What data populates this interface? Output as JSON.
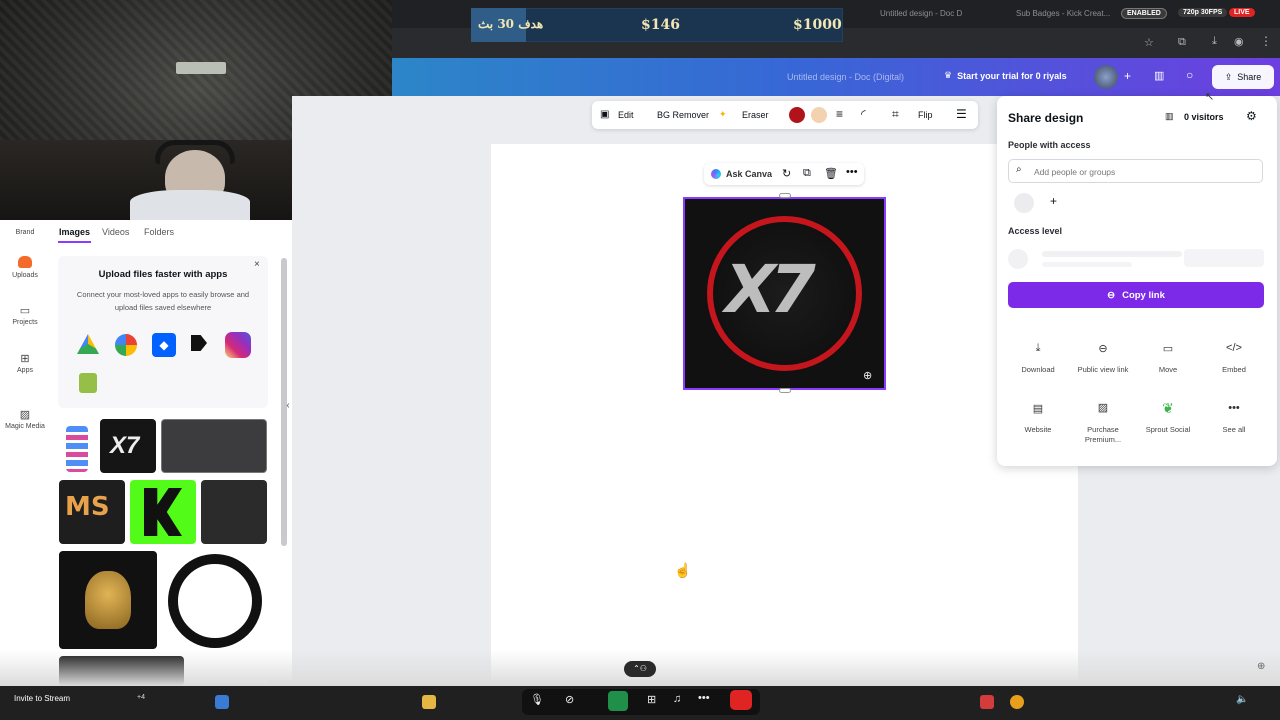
{
  "stream_overlay": {
    "goal_label": "هدف 30 بث",
    "donation_current": "$146",
    "donation_target": "$1000",
    "enabled_badge": "ENABLED",
    "quality_badge": "720p 30FPS",
    "live_badge": "LIVE"
  },
  "browser": {
    "tabs": [
      "Untitled design - Doc D",
      "Sub Badges - Kick Creat..."
    ]
  },
  "header": {
    "doc_title": "Untitled design - Doc (Digital)",
    "trial_button": "Start your trial for 0 riyals",
    "share_label": "Share"
  },
  "left_rail": {
    "items": [
      {
        "label": "Brand",
        "icon": "crown-icon"
      },
      {
        "label": "Uploads",
        "icon": "cloud-upload-icon"
      },
      {
        "label": "Projects",
        "icon": "folder-icon"
      },
      {
        "label": "Apps",
        "icon": "apps-icon"
      },
      {
        "label": "Magic Media",
        "icon": "magic-media-icon"
      }
    ]
  },
  "side_panel": {
    "tabs": [
      "Images",
      "Videos",
      "Folders"
    ],
    "active_tab": "Images",
    "upload_card": {
      "title": "Upload files faster with apps",
      "body": "Connect your most-loved apps to easily browse and upload files saved elsewhere",
      "apps": [
        "google-drive-icon",
        "google-photos-icon",
        "dropbox-icon",
        "kick-icon",
        "instagram-icon",
        "shopify-icon"
      ]
    }
  },
  "toolbar": {
    "edit": "Edit",
    "bg_remover": "BG Remover",
    "eraser": "Eraser",
    "flip": "Flip",
    "color_1": "#b0141a",
    "color_2": "#f2d2b0"
  },
  "element_menu": {
    "ask_canva": "Ask Canva"
  },
  "canvas_logo": {
    "text": "X7",
    "ring_color": "#c4161c"
  },
  "share_panel": {
    "title": "Share design",
    "visitors": "0 visitors",
    "people_label": "People with access",
    "search_placeholder": "Add people or groups",
    "access_label": "Access level",
    "copy_link": "Copy link",
    "actions": [
      {
        "label": "Download",
        "icon": "download-icon"
      },
      {
        "label": "Public view link",
        "icon": "link-icon"
      },
      {
        "label": "Move",
        "icon": "folder-icon"
      },
      {
        "label": "Embed",
        "icon": "code-icon"
      },
      {
        "label": "Website",
        "icon": "website-icon"
      },
      {
        "label": "Purchase Premium...",
        "icon": "image-icon"
      },
      {
        "label": "Sprout Social",
        "icon": "sprout-leaf-icon"
      },
      {
        "label": "See all",
        "icon": "more-icon"
      }
    ]
  },
  "discord": {
    "invite_label": "Invite to Stream",
    "viewer_count": "+4"
  },
  "colors": {
    "brand_purple": "#8b3dff",
    "copy_link_bg": "#7d2ae8",
    "live_red": "#e02424"
  }
}
